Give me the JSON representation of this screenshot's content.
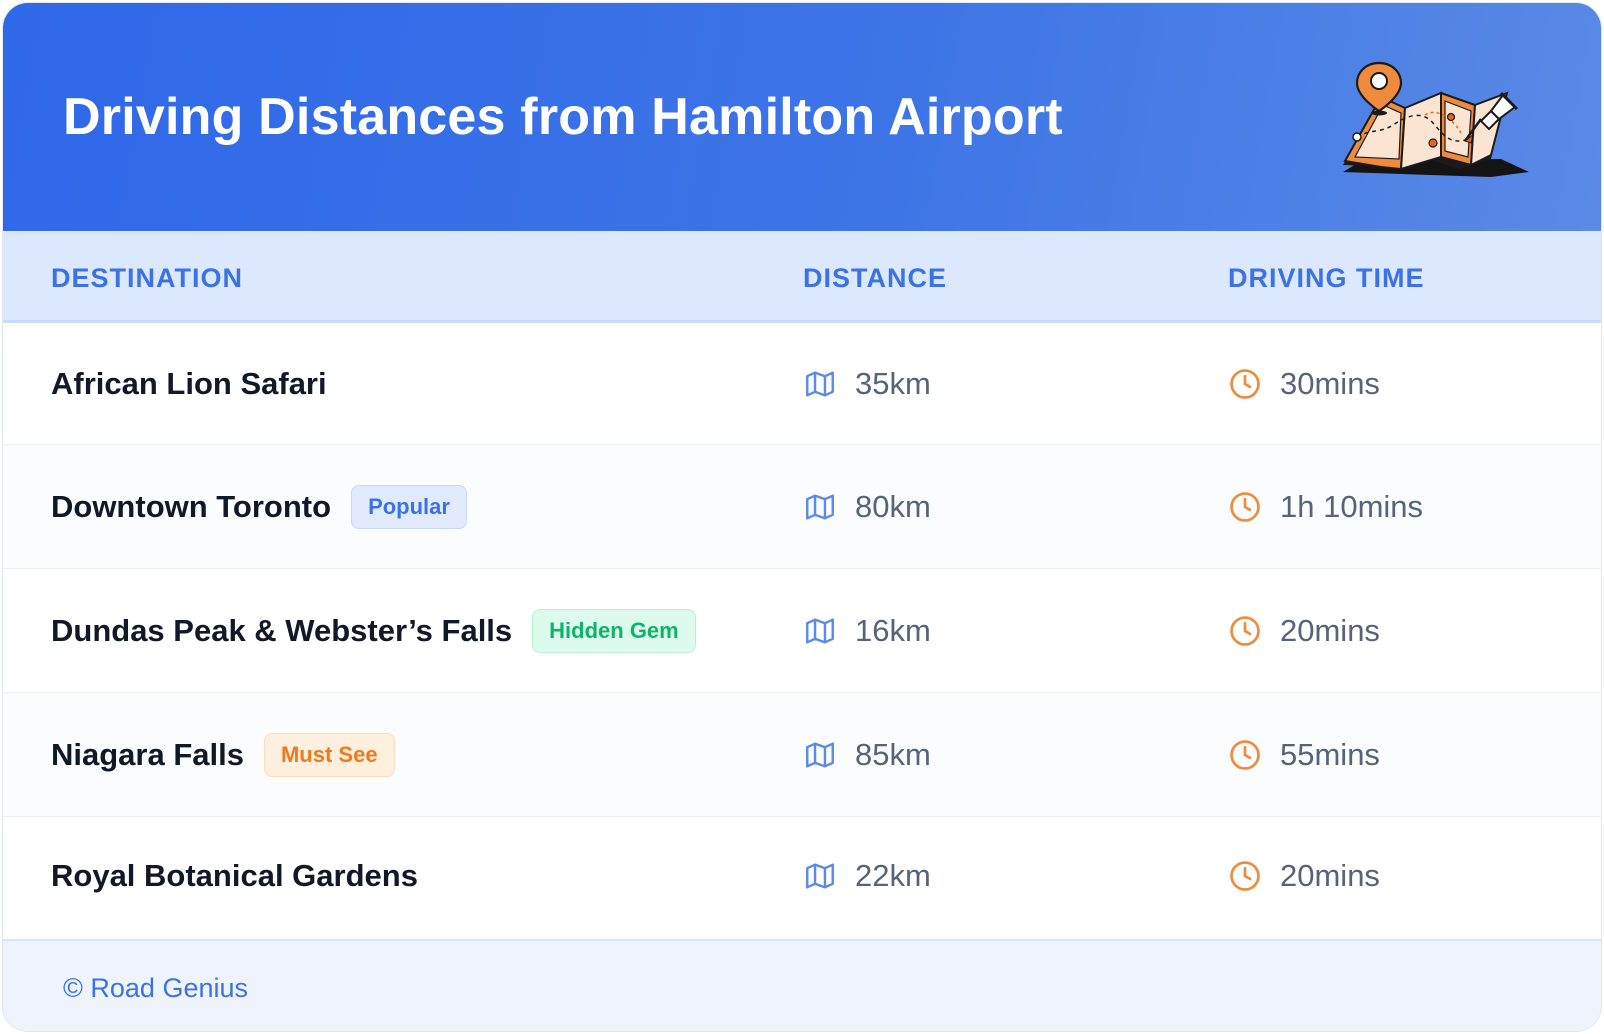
{
  "header": {
    "title": "Driving Distances from Hamilton Airport",
    "illustration_icon": "map-with-pins-icon"
  },
  "table": {
    "columns": [
      "DESTINATION",
      "DISTANCE",
      "DRIVING TIME"
    ],
    "distance_icon": "map-icon",
    "time_icon": "clock-icon",
    "rows": [
      {
        "destination": "African Lion Safari",
        "badge": "",
        "distance": "35km",
        "time": "30mins"
      },
      {
        "destination": "Downtown Toronto",
        "badge": "Popular",
        "badge_color": "#3b73e4",
        "distance": "80km",
        "time": "1h 10mins"
      },
      {
        "destination": "Dundas Peak & Webster’s Falls",
        "badge": "Hidden Gem",
        "badge_color": "#10b36a",
        "distance": "16km",
        "time": "20mins"
      },
      {
        "destination": "Niagara Falls",
        "badge": "Must See",
        "badge_color": "#f07a1a",
        "distance": "85km",
        "time": "55mins"
      },
      {
        "destination": "Royal Botanical Gardens",
        "badge": "",
        "distance": "22km",
        "time": "20mins"
      }
    ]
  },
  "footer": {
    "text": "© Road Genius"
  },
  "colors": {
    "header_gradient_start": "#2f68e9",
    "header_gradient_end": "#5a8ae6",
    "accent_blue": "#3b73e4",
    "clock_orange": "#f08a3c"
  }
}
